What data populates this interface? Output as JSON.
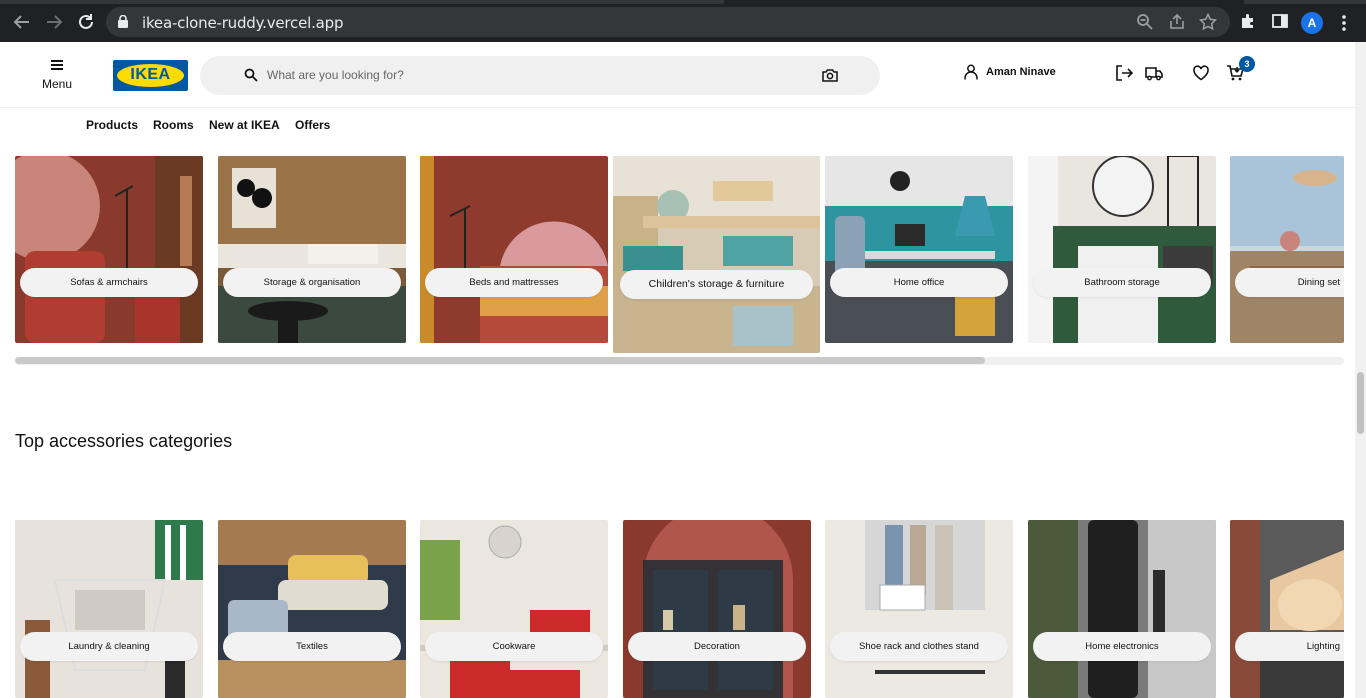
{
  "browser": {
    "url": "ikea-clone-ruddy.vercel.app",
    "profile_initial": "A"
  },
  "header": {
    "menu_label": "Menu",
    "logo_text": "IKEA",
    "search_placeholder": "What are you looking for?",
    "user_name": "Aman Ninave",
    "cart_count": "3"
  },
  "nav": {
    "items": [
      "Products",
      "Rooms",
      "New at IKEA",
      "Offers"
    ]
  },
  "room_categories": [
    {
      "label": "Sofas & armchairs"
    },
    {
      "label": "Storage & organisation"
    },
    {
      "label": "Beds and mattresses"
    },
    {
      "label": "Children's storage & furniture"
    },
    {
      "label": "Home office"
    },
    {
      "label": "Bathroom storage"
    },
    {
      "label": "Dining set"
    }
  ],
  "accessories": {
    "title": "Top accessories categories",
    "items": [
      {
        "label": "Laundry & cleaning"
      },
      {
        "label": "Textiles"
      },
      {
        "label": "Cookware"
      },
      {
        "label": "Decoration"
      },
      {
        "label": "Shoe rack and clothes stand"
      },
      {
        "label": "Home electronics"
      },
      {
        "label": "Lighting"
      }
    ]
  },
  "colors": {
    "brand_blue": "#0058a3",
    "brand_yellow": "#ffdb00"
  }
}
